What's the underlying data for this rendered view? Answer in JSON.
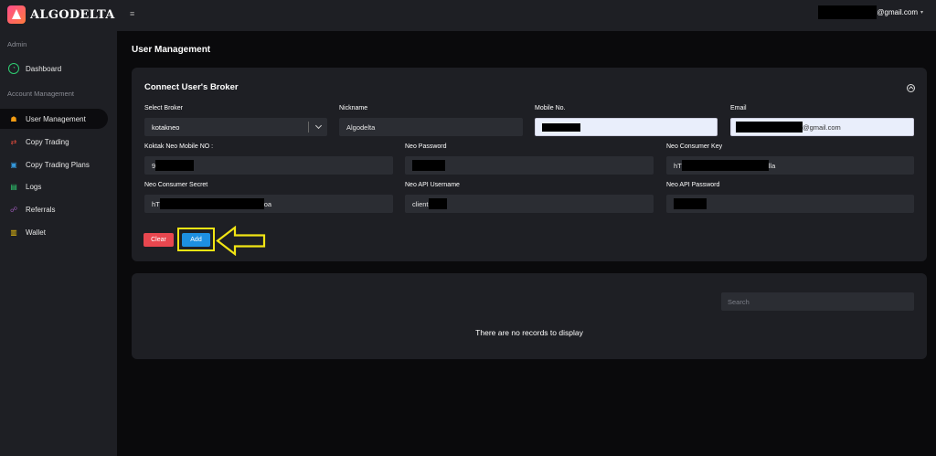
{
  "app": {
    "name": "ALGODELTA"
  },
  "sidebar": {
    "sections": [
      {
        "label": "Admin"
      },
      {
        "label": "Account Management"
      }
    ],
    "items": [
      {
        "label": "Dashboard",
        "icon": "dashboard-icon",
        "color": "#2ecc71"
      },
      {
        "label": "User Management",
        "icon": "users-icon",
        "color": "#f39c12"
      },
      {
        "label": "Copy Trading",
        "icon": "copy-trading-icon",
        "color": "#e74c3c"
      },
      {
        "label": "Copy Trading Plans",
        "icon": "plans-icon",
        "color": "#3498db"
      },
      {
        "label": "Logs",
        "icon": "logs-icon",
        "color": "#2ecc71"
      },
      {
        "label": "Referrals",
        "icon": "referrals-icon",
        "color": "#8e44ad"
      },
      {
        "label": "Wallet",
        "icon": "wallet-icon",
        "color": "#f1c40f"
      }
    ]
  },
  "topbar": {
    "menu_icon": "≡",
    "email_suffix": "@gmail.com",
    "caret": "▾"
  },
  "page": {
    "title": "User Management"
  },
  "form": {
    "title": "Connect User's Broker",
    "fields": {
      "broker": {
        "label": "Select Broker",
        "value": "kotakneo"
      },
      "nickname": {
        "label": "Nickname",
        "value": "Algodelta"
      },
      "mobile": {
        "label": "Mobile No.",
        "value": ""
      },
      "email": {
        "label": "Email",
        "value": "@gmail.com"
      },
      "neo_mobile": {
        "label": "Koktak Neo Mobile NO :",
        "value": "9"
      },
      "neo_password": {
        "label": "Neo Password",
        "value": ""
      },
      "consumer_key": {
        "label": "Neo Consumer Key",
        "value_prefix": "hT",
        "value_suffix": "lla"
      },
      "consumer_secret": {
        "label": "Neo Consumer Secret",
        "value_prefix": "hT",
        "value_suffix": "oa"
      },
      "api_username": {
        "label": "Neo API Username",
        "value": "client"
      },
      "api_password": {
        "label": "Neo API Password",
        "value": ""
      }
    },
    "buttons": {
      "clear": "Clear",
      "add": "Add"
    },
    "colors": {
      "clear": "#e8474f",
      "add": "#1d8fe1",
      "highlight": "#f2e514"
    }
  },
  "records": {
    "search_placeholder": "Search",
    "empty_text": "There are no records to display"
  }
}
